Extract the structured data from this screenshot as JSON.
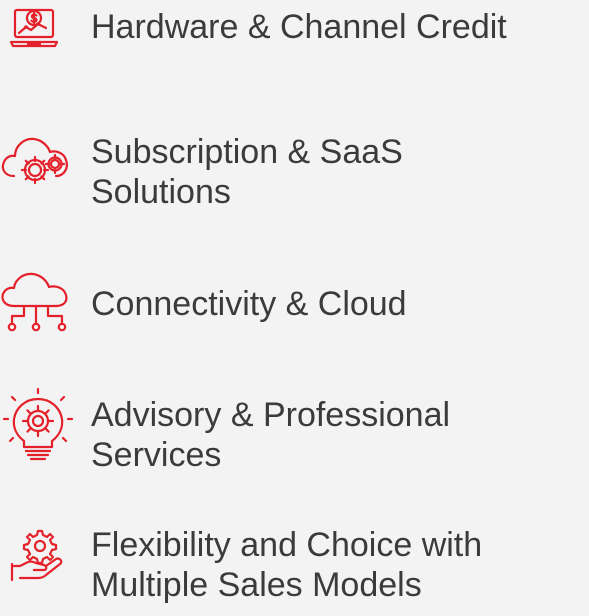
{
  "accent_color": "#e4212a",
  "items": [
    {
      "icon": "laptop-dollar-chart-icon",
      "lines": [
        "Hardware & Channel Credit"
      ]
    },
    {
      "icon": "cloud-gear-icon",
      "lines": [
        "Subscription & SaaS",
        "Solutions"
      ]
    },
    {
      "icon": "cloud-network-icon",
      "lines": [
        "Connectivity & Cloud"
      ]
    },
    {
      "icon": "lightbulb-gear-icon",
      "lines": [
        "Advisory & Professional",
        "Services"
      ]
    },
    {
      "icon": "hand-gear-icon",
      "lines": [
        "Flexibility and Choice with",
        "Multiple Sales Models"
      ]
    }
  ]
}
